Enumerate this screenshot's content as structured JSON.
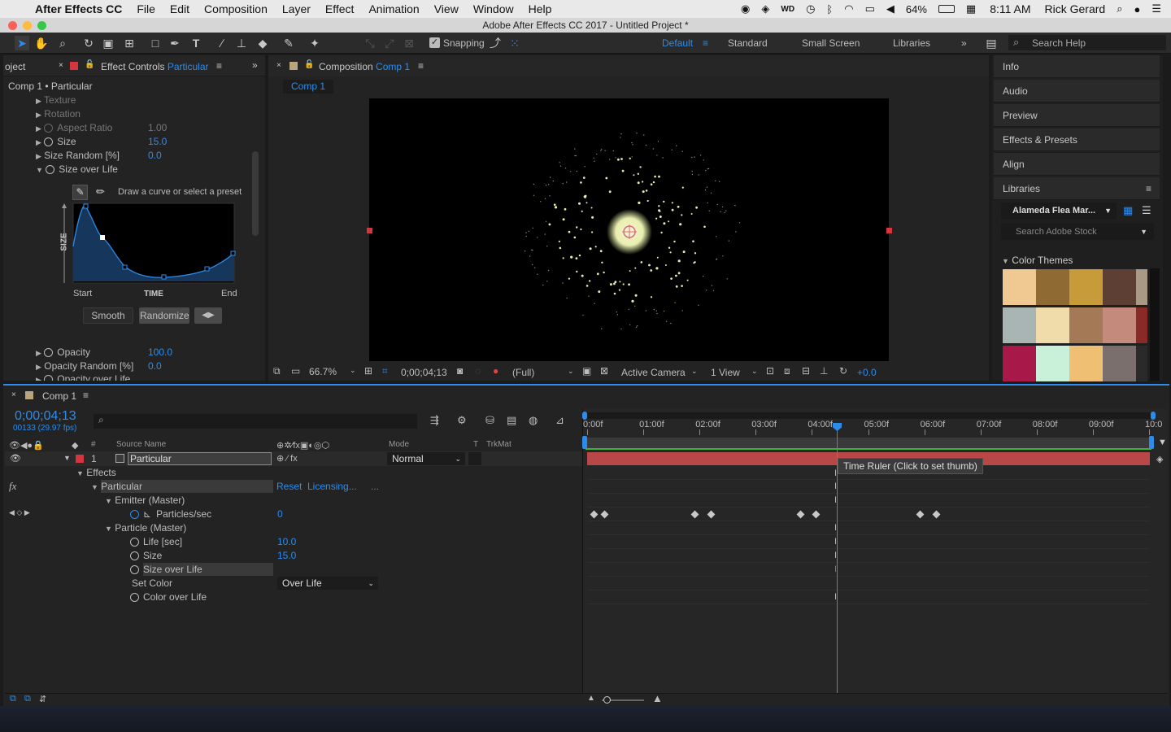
{
  "menubar": {
    "app": "After Effects CC",
    "items": [
      "File",
      "Edit",
      "Composition",
      "Layer",
      "Effect",
      "Animation",
      "View",
      "Window",
      "Help"
    ],
    "battery": "64%",
    "time": "8:11 AM",
    "user": "Rick Gerard"
  },
  "window_title": "Adobe After Effects CC 2017 - Untitled Project *",
  "toolbar": {
    "snapping": "Snapping",
    "workspaces": [
      "Default",
      "Standard",
      "Small Screen",
      "Libraries"
    ],
    "active_workspace": "Default",
    "search_placeholder": "Search Help"
  },
  "effect_controls": {
    "tab_left": "oject",
    "tab_label": "Effect Controls",
    "tab_target": "Particular",
    "breadcrumb": "Comp 1 • Particular",
    "rows": [
      {
        "label": "Texture",
        "value": ""
      },
      {
        "label": "Rotation",
        "value": ""
      },
      {
        "label": "Aspect Ratio",
        "value": "1.00"
      },
      {
        "label": "Size",
        "value": "15.0"
      },
      {
        "label": "Size Random [%]",
        "value": "0.0"
      },
      {
        "label": "Size over Life",
        "value": ""
      }
    ],
    "curve_hint": "Draw a curve or select a preset",
    "curve_ylabel": "SIZE",
    "curve_start": "Start",
    "curve_time": "TIME",
    "curve_end": "End",
    "smooth": "Smooth",
    "randomize": "Randomize",
    "rows2": [
      {
        "label": "Opacity",
        "value": "100.0"
      },
      {
        "label": "Opacity Random [%]",
        "value": "0.0"
      },
      {
        "label": "Opacity over Life",
        "value": ""
      }
    ]
  },
  "composition": {
    "tab_label": "Composition",
    "tab_target": "Comp 1",
    "subtab": "Comp 1",
    "zoom": "66.7%",
    "timecode": "0;00;04;13",
    "resolution": "(Full)",
    "camera": "Active Camera",
    "views": "1 View",
    "exposure": "+0.0"
  },
  "right_panel": {
    "items": [
      "Info",
      "Audio",
      "Preview",
      "Effects & Presets",
      "Align",
      "Libraries"
    ],
    "library_name": "Alameda Flea Mar...",
    "stock_placeholder": "Search Adobe Stock",
    "color_themes": "Color Themes",
    "swatches": [
      [
        "#f0c891",
        "#8f6a32",
        "#c79a3a",
        "#5d4033",
        "#a99a86"
      ],
      [
        "#a9b5b2",
        "#efdcaa",
        "#a37a55",
        "#c48a7b",
        "#8a2a26"
      ],
      [
        "#a8194a",
        "#c9f0d8",
        "#efc073",
        "#7a6f6c",
        "#2a2a2a"
      ]
    ]
  },
  "timeline": {
    "tab": "Comp 1",
    "timecode": "0;00;04;13",
    "fps": "00133 (29.97 fps)",
    "ruler": [
      "0:00f",
      "01:00f",
      "02:00f",
      "03:00f",
      "04:00f",
      "05:00f",
      "06:00f",
      "07:00f",
      "08:00f",
      "09:00f",
      "10:0"
    ],
    "col_source": "Source Name",
    "col_mode": "Mode",
    "col_t": "T",
    "col_trkmat": "TrkMat",
    "layer_num": "1",
    "layer_name": "Particular",
    "layer_mode": "Normal",
    "tooltip": "Time Ruler (Click to set thumb)",
    "props": [
      {
        "label": "Effects",
        "value": ""
      },
      {
        "label": "Particular",
        "value": "Reset"
      },
      {
        "label": "Emitter (Master)",
        "value": ""
      },
      {
        "label": "Particles/sec",
        "value": "0"
      },
      {
        "label": "Particle (Master)",
        "value": ""
      },
      {
        "label": "Life [sec]",
        "value": "10.0"
      },
      {
        "label": "Size",
        "value": "15.0"
      },
      {
        "label": "Size over Life",
        "value": ""
      },
      {
        "label": "Set Color",
        "value": "Over Life"
      },
      {
        "label": "Color over Life",
        "value": ""
      }
    ],
    "licensing": "Licensing...",
    "ellipsis": "..."
  }
}
